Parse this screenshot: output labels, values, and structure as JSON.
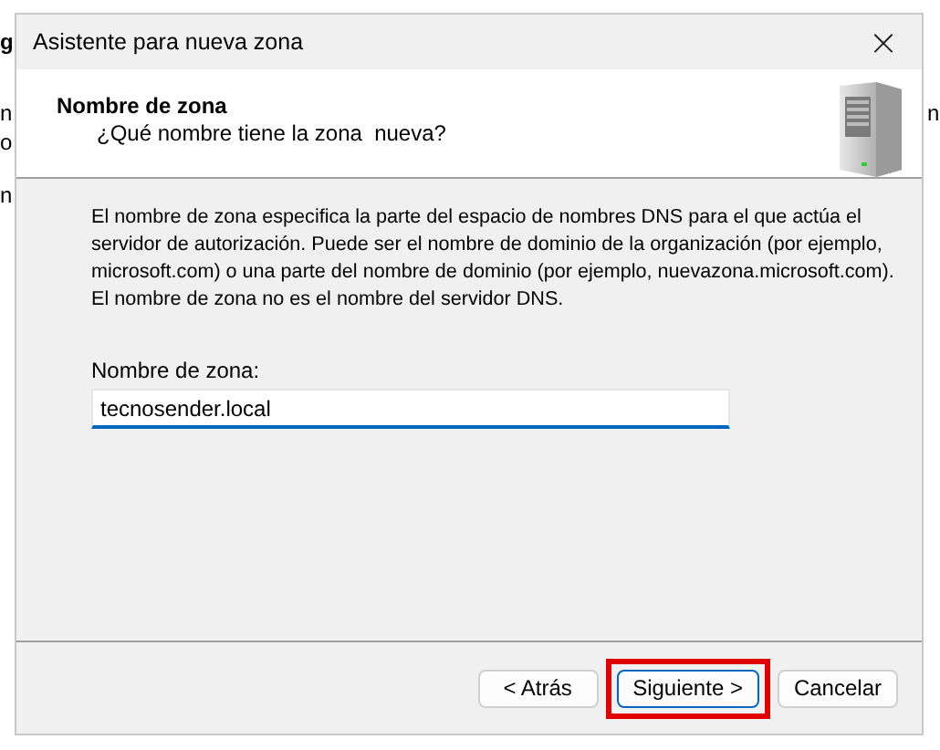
{
  "background_window": {
    "left_edge": [
      {
        "text": "g",
        "bold": true
      },
      {
        "text": "n",
        "bold": false
      },
      {
        "text": "o",
        "bold": false
      },
      {
        "text": "n",
        "bold": false
      }
    ],
    "right_edge": [
      {
        "text": "n",
        "bold": false
      }
    ]
  },
  "window": {
    "title": "Asistente para nueva zona",
    "close": "×"
  },
  "header": {
    "title": "Nombre de zona",
    "subtitle": "¿Qué nombre tiene la zona  nueva?"
  },
  "description": "El nombre de zona especifica la parte del espacio de nombres DNS para el que actúa el servidor de autorización. Puede ser el nombre de dominio de la organización (por ejemplo, microsoft.com) o una parte del nombre de dominio (por ejemplo, nuevazona.microsoft.com). El nombre de zona no es el nombre del servidor DNS.",
  "zone_name": {
    "label": "Nombre de zona:",
    "value": "tecnosender.local",
    "focused": true
  },
  "buttons": [
    {
      "label": "< Atrás",
      "highlighted": false
    },
    {
      "label": "Siguiente >",
      "highlighted": true
    },
    {
      "label": "Cancelar",
      "highlighted": false
    }
  ]
}
